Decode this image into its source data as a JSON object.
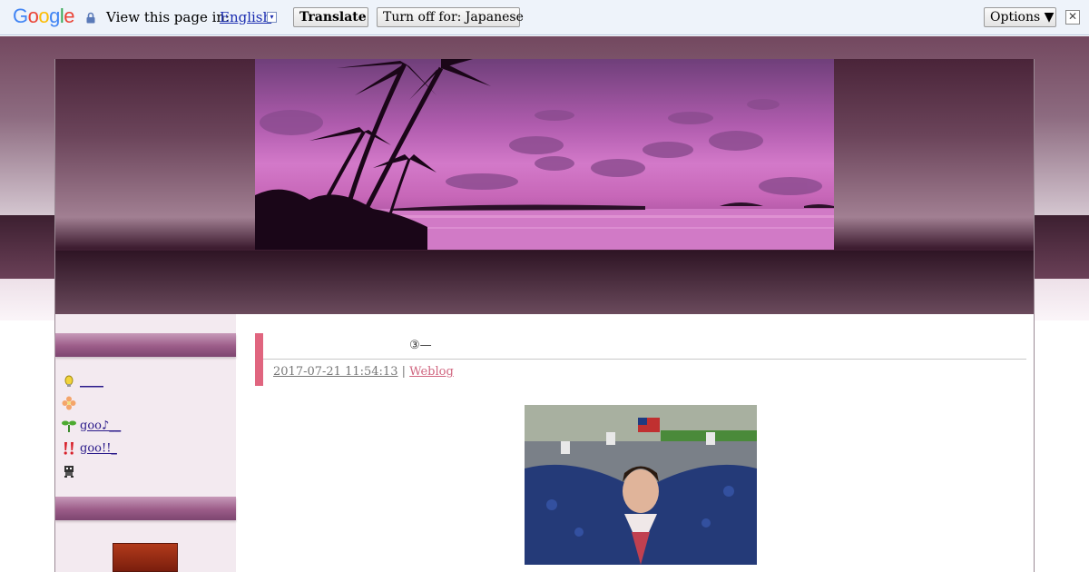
{
  "translate_bar": {
    "logo_text": "Google",
    "view_label": "View this page in:",
    "language": "English",
    "language_arrow": "▾",
    "translate_button": "Translate",
    "turn_off_button": "Turn off for: Japanese",
    "options_button": "Options ▼",
    "close_glyph": "✕"
  },
  "sidebar": {
    "items": [
      {
        "icon": "bulb-icon",
        "label": "____"
      },
      {
        "icon": "flower-icon",
        "label": ""
      },
      {
        "icon": "sprout-icon",
        "label": "goo♪__"
      },
      {
        "icon": "exclamation-icon",
        "label": "goo!!_"
      },
      {
        "icon": "robot-icon",
        "label": ""
      }
    ]
  },
  "post": {
    "title": "③—",
    "date": "2017-07-21 11:54:13",
    "separator": "|",
    "category": "Weblog"
  },
  "colors": {
    "accent": "#e0657f",
    "link": "#2a1a8a",
    "sidebar_head": "#9b5c88"
  }
}
